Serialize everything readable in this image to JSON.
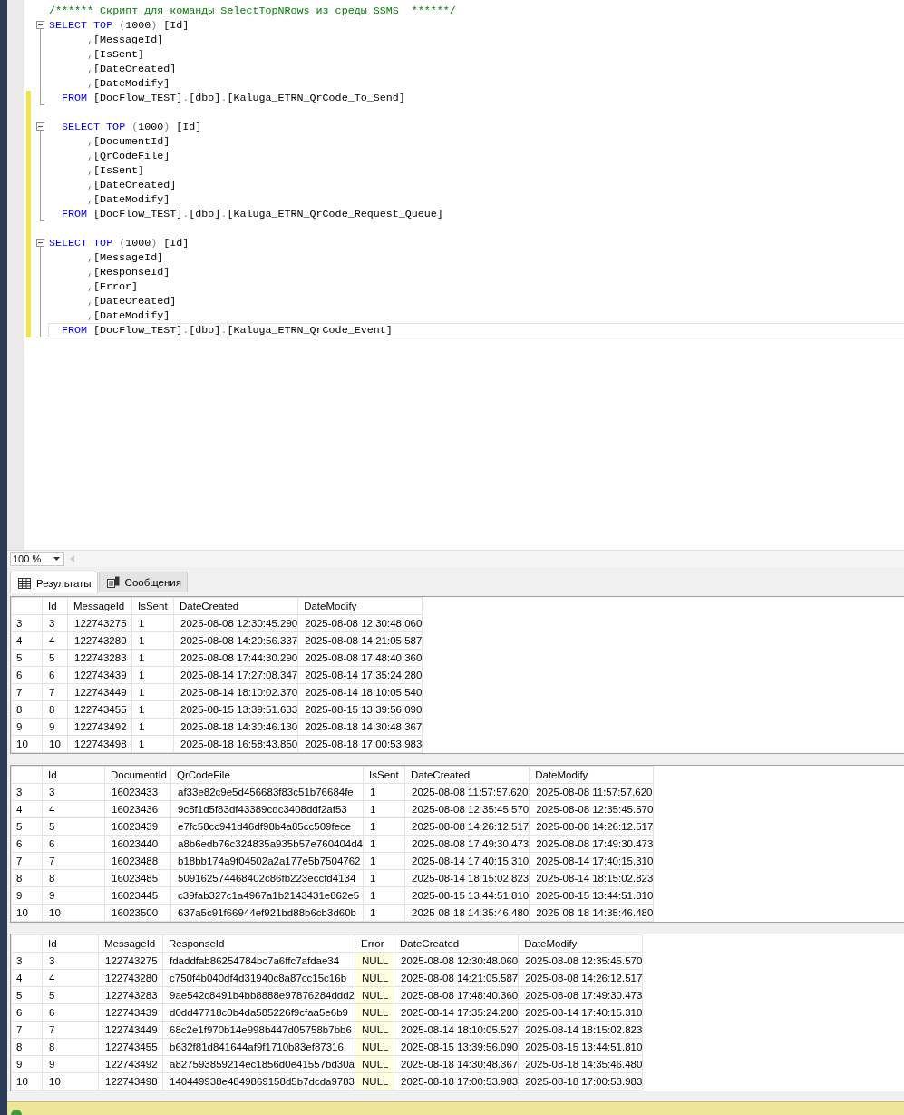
{
  "editor": {
    "lines": [
      {
        "kind": "comment",
        "text": "/****** Скрипт для команды SelectTopNRows из среды SSMS  ******/"
      },
      {
        "kind": "select",
        "expanded": true,
        "keyword": "SELECT",
        "top": "TOP",
        "open": "(",
        "count": "1000",
        "close": ")",
        "column": "[Id]"
      },
      {
        "kind": "column",
        "in_block": true,
        "comma": ",",
        "name": "[MessageId]"
      },
      {
        "kind": "column",
        "in_block": true,
        "comma": ",",
        "name": "[IsSent]"
      },
      {
        "kind": "column",
        "in_block": true,
        "comma": ",",
        "name": "[DateCreated]"
      },
      {
        "kind": "column",
        "in_block": true,
        "comma": ",",
        "name": "[DateModify]"
      },
      {
        "kind": "from",
        "block_end": true,
        "changed": true,
        "indented": true,
        "keyword": "FROM",
        "path": [
          {
            "name": "[DocFlow_TEST]",
            "dot": "."
          },
          {
            "name": "[dbo]",
            "dot": "."
          },
          {
            "name": "[Kaluga_ETRN_QrCode_To_Send]"
          }
        ]
      },
      {
        "kind": "blank",
        "changed": true
      },
      {
        "kind": "select",
        "expanded": true,
        "changed": true,
        "indented": true,
        "keyword": "SELECT",
        "top": "TOP",
        "open": "(",
        "count": "1000",
        "close": ")",
        "column": "[Id]"
      },
      {
        "kind": "column",
        "in_block": true,
        "changed": true,
        "comma": ",",
        "name": "[DocumentId]"
      },
      {
        "kind": "column",
        "in_block": true,
        "changed": true,
        "comma": ",",
        "name": "[QrCodeFile]"
      },
      {
        "kind": "column",
        "in_block": true,
        "changed": true,
        "comma": ",",
        "name": "[IsSent]"
      },
      {
        "kind": "column",
        "in_block": true,
        "changed": true,
        "comma": ",",
        "name": "[DateCreated]"
      },
      {
        "kind": "column",
        "in_block": true,
        "changed": true,
        "comma": ",",
        "name": "[DateModify]"
      },
      {
        "kind": "from",
        "block_end": true,
        "changed": true,
        "indented": true,
        "keyword": "FROM",
        "path": [
          {
            "name": "[DocFlow_TEST]",
            "dot": "."
          },
          {
            "name": "[dbo]",
            "dot": "."
          },
          {
            "name": "[Kaluga_ETRN_QrCode_Request_Queue]"
          }
        ]
      },
      {
        "kind": "blank",
        "changed": true
      },
      {
        "kind": "select",
        "expanded": true,
        "changed": true,
        "keyword": "SELECT",
        "top": "TOP",
        "open": "(",
        "count": "1000",
        "close": ")",
        "column": "[Id]"
      },
      {
        "kind": "column",
        "in_block": true,
        "changed": true,
        "comma": ",",
        "name": "[MessageId]"
      },
      {
        "kind": "column",
        "in_block": true,
        "changed": true,
        "comma": ",",
        "name": "[ResponseId]"
      },
      {
        "kind": "column",
        "in_block": true,
        "changed": true,
        "comma": ",",
        "name": "[Error]"
      },
      {
        "kind": "column",
        "in_block": true,
        "changed": true,
        "comma": ",",
        "name": "[DateCreated]"
      },
      {
        "kind": "column",
        "in_block": true,
        "changed": true,
        "comma": ",",
        "name": "[DateModify]"
      },
      {
        "kind": "from",
        "block_end": true,
        "changed": true,
        "indented": true,
        "current": true,
        "keyword": "FROM",
        "path": [
          {
            "name": "[DocFlow_TEST]",
            "dot": "."
          },
          {
            "name": "[dbo]",
            "dot": "."
          },
          {
            "name": "[Kaluga_ETRN_QrCode_Event]"
          }
        ]
      }
    ]
  },
  "zoom": {
    "value": "100 %"
  },
  "tabs": [
    {
      "label": "Результаты",
      "kind": "grid",
      "selected": true
    },
    {
      "label": "Сообщения",
      "kind": "messages",
      "selected": false
    }
  ],
  "grids": [
    {
      "columns": [
        {
          "label": "Id"
        },
        {
          "label": "MessageId"
        },
        {
          "label": "IsSent"
        },
        {
          "label": "DateCreated"
        },
        {
          "label": "DateModify"
        }
      ],
      "rows": [
        {
          "num": "3",
          "cells": [
            "3",
            "122743275",
            "1",
            "2025-08-08 12:30:45.290",
            "2025-08-08 12:30:48.060"
          ]
        },
        {
          "num": "4",
          "cells": [
            "4",
            "122743280",
            "1",
            "2025-08-08 14:20:56.337",
            "2025-08-08 14:21:05.587"
          ]
        },
        {
          "num": "5",
          "cells": [
            "5",
            "122743283",
            "1",
            "2025-08-08 17:44:30.290",
            "2025-08-08 17:48:40.360"
          ]
        },
        {
          "num": "6",
          "cells": [
            "6",
            "122743439",
            "1",
            "2025-08-14 17:27:08.347",
            "2025-08-14 17:35:24.280"
          ]
        },
        {
          "num": "7",
          "cells": [
            "7",
            "122743449",
            "1",
            "2025-08-14 18:10:02.370",
            "2025-08-14 18:10:05.540"
          ]
        },
        {
          "num": "8",
          "cells": [
            "8",
            "122743455",
            "1",
            "2025-08-15 13:39:51.633",
            "2025-08-15 13:39:56.090"
          ]
        },
        {
          "num": "9",
          "cells": [
            "9",
            "122743492",
            "1",
            "2025-08-18 14:30:46.130",
            "2025-08-18 14:30:48.367"
          ]
        },
        {
          "num": "10",
          "cells": [
            "10",
            "122743498",
            "1",
            "2025-08-18 16:58:43.850",
            "2025-08-18 17:00:53.983"
          ]
        }
      ]
    },
    {
      "columns": [
        {
          "label": "Id"
        },
        {
          "label": "DocumentId"
        },
        {
          "label": "QrCodeFile"
        },
        {
          "label": "IsSent"
        },
        {
          "label": "DateCreated"
        },
        {
          "label": "DateModify"
        }
      ],
      "rows": [
        {
          "num": "3",
          "cells": [
            "3",
            "16023433",
            "af33e82c9e5d456683f83c51b76684fe",
            "1",
            "2025-08-08 11:57:57.620",
            "2025-08-08 11:57:57.620"
          ]
        },
        {
          "num": "4",
          "cells": [
            "4",
            "16023436",
            "9c8f1d5f83df43389cdc3408ddf2af53",
            "1",
            "2025-08-08 12:35:45.570",
            "2025-08-08 12:35:45.570"
          ]
        },
        {
          "num": "5",
          "cells": [
            "5",
            "16023439",
            "e7fc58cc941d46df98b4a85cc509fece",
            "1",
            "2025-08-08 14:26:12.517",
            "2025-08-08 14:26:12.517"
          ]
        },
        {
          "num": "6",
          "cells": [
            "6",
            "16023440",
            "a8b6edb76c324835a935b57e760404d4",
            "1",
            "2025-08-08 17:49:30.473",
            "2025-08-08 17:49:30.473"
          ]
        },
        {
          "num": "7",
          "cells": [
            "7",
            "16023488",
            "b18bb174a9f04502a2a177e5b7504762",
            "1",
            "2025-08-14 17:40:15.310",
            "2025-08-14 17:40:15.310"
          ]
        },
        {
          "num": "8",
          "cells": [
            "8",
            "16023485",
            "509162574468402c86fb223eccfd4134",
            "1",
            "2025-08-14 18:15:02.823",
            "2025-08-14 18:15:02.823"
          ]
        },
        {
          "num": "9",
          "cells": [
            "9",
            "16023445",
            "c39fab327c1a4967a1b2143431e862e5",
            "1",
            "2025-08-15 13:44:51.810",
            "2025-08-15 13:44:51.810"
          ]
        },
        {
          "num": "10",
          "cells": [
            "10",
            "16023500",
            "637a5c91f66944ef921bd88b6cb3d60b",
            "1",
            "2025-08-18 14:35:46.480",
            "2025-08-18 14:35:46.480"
          ]
        }
      ]
    },
    {
      "columns": [
        {
          "label": "Id"
        },
        {
          "label": "MessageId"
        },
        {
          "label": "ResponseId"
        },
        {
          "label": "Error",
          "null_values": true
        },
        {
          "label": "DateCreated"
        },
        {
          "label": "DateModify"
        }
      ],
      "rows": [
        {
          "num": "3",
          "cells": [
            "3",
            "122743275",
            "fdaddfab86254784bc7a6ffc7afdae34",
            "NULL",
            "2025-08-08 12:30:48.060",
            "2025-08-08 12:35:45.570"
          ]
        },
        {
          "num": "4",
          "cells": [
            "4",
            "122743280",
            "c750f4b040df4d31940c8a87cc15c16b",
            "NULL",
            "2025-08-08 14:21:05.587",
            "2025-08-08 14:26:12.517"
          ]
        },
        {
          "num": "5",
          "cells": [
            "5",
            "122743283",
            "9ae542c8491b4bb8888e97876284ddd2",
            "NULL",
            "2025-08-08 17:48:40.360",
            "2025-08-08 17:49:30.473"
          ]
        },
        {
          "num": "6",
          "cells": [
            "6",
            "122743439",
            "d0dd47718c0b4da585226f9cfaa5e6b9",
            "NULL",
            "2025-08-14 17:35:24.280",
            "2025-08-14 17:40:15.310"
          ]
        },
        {
          "num": "7",
          "cells": [
            "7",
            "122743449",
            "68c2e1f970b14e998b447d05758b7bb6",
            "NULL",
            "2025-08-14 18:10:05.527",
            "2025-08-14 18:15:02.823"
          ]
        },
        {
          "num": "8",
          "cells": [
            "8",
            "122743455",
            "b632f81d841644af9f1710b83ef87316",
            "NULL",
            "2025-08-15 13:39:56.090",
            "2025-08-15 13:44:51.810"
          ]
        },
        {
          "num": "9",
          "cells": [
            "9",
            "122743492",
            "a827593859214ec1856d0e41557bd30a",
            "NULL",
            "2025-08-18 14:30:48.367",
            "2025-08-18 14:35:46.480"
          ]
        },
        {
          "num": "10",
          "cells": [
            "10",
            "122743498",
            "140449938e4849869158d5b7dcda9783",
            "NULL",
            "2025-08-18 17:00:53.983",
            "2025-08-18 17:00:53.983"
          ]
        }
      ]
    }
  ],
  "status_bar": {
    "success": true
  }
}
